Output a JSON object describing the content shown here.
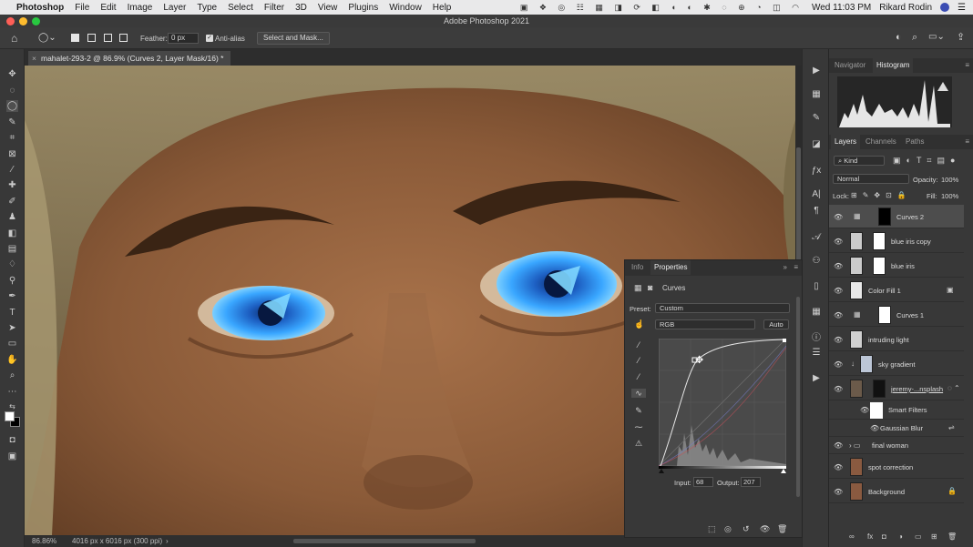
{
  "menubar": {
    "app": "Photoshop",
    "items": [
      "File",
      "Edit",
      "Image",
      "Layer",
      "Type",
      "Select",
      "Filter",
      "3D",
      "View",
      "Plugins",
      "Window",
      "Help"
    ],
    "datetime": "Wed 11:03 PM",
    "user": "Rikard Rodin"
  },
  "window": {
    "title": "Adobe Photoshop 2021"
  },
  "options": {
    "feather_label": "Feather:",
    "feather_value": "0 px",
    "antialias_label": "Anti-alias",
    "select_mask": "Select and Mask..."
  },
  "document": {
    "tab_label": "mahalet-293-2 @ 86.9% (Curves 2, Layer Mask/16) *",
    "zoom": "86.86%",
    "size_info": "4016 px x 6016 px (300 ppi)"
  },
  "navigator": {
    "tabs": [
      "Navigator",
      "Histogram"
    ],
    "active": "Histogram"
  },
  "layers_panel": {
    "tabs": [
      "Layers",
      "Channels",
      "Paths"
    ],
    "active": "Layers",
    "filter_kind": "Kind",
    "blend_mode": "Normal",
    "opacity_label": "Opacity:",
    "opacity_value": "100%",
    "lock_label": "Lock:",
    "fill_label": "Fill:",
    "fill_value": "100%",
    "layers": [
      {
        "name": "Curves 2",
        "selected": true
      },
      {
        "name": "blue iris copy"
      },
      {
        "name": "blue iris"
      },
      {
        "name": "Color Fill 1"
      },
      {
        "name": "Curves 1"
      },
      {
        "name": "intruding light"
      },
      {
        "name": "sky gradient"
      },
      {
        "name": "jeremy-...nsplash"
      },
      {
        "name": "Smart Filters"
      },
      {
        "name": "Gaussian Blur"
      },
      {
        "name": "final woman"
      },
      {
        "name": "spot correction"
      },
      {
        "name": "Background"
      }
    ]
  },
  "properties_panel": {
    "tabs": [
      "Info",
      "Properties"
    ],
    "active": "Properties",
    "adjustment": "Curves",
    "preset_label": "Preset:",
    "preset_value": "Custom",
    "channel_value": "RGB",
    "auto_button": "Auto",
    "input_label": "Input:",
    "input_value": "68",
    "output_label": "Output:",
    "output_value": "207"
  },
  "colors": {
    "menubar_bg": "#e9e9ea",
    "panel_bg": "#383838",
    "selected_layer": "#4d4d4d",
    "iris_blue": "#2f8fe8"
  }
}
